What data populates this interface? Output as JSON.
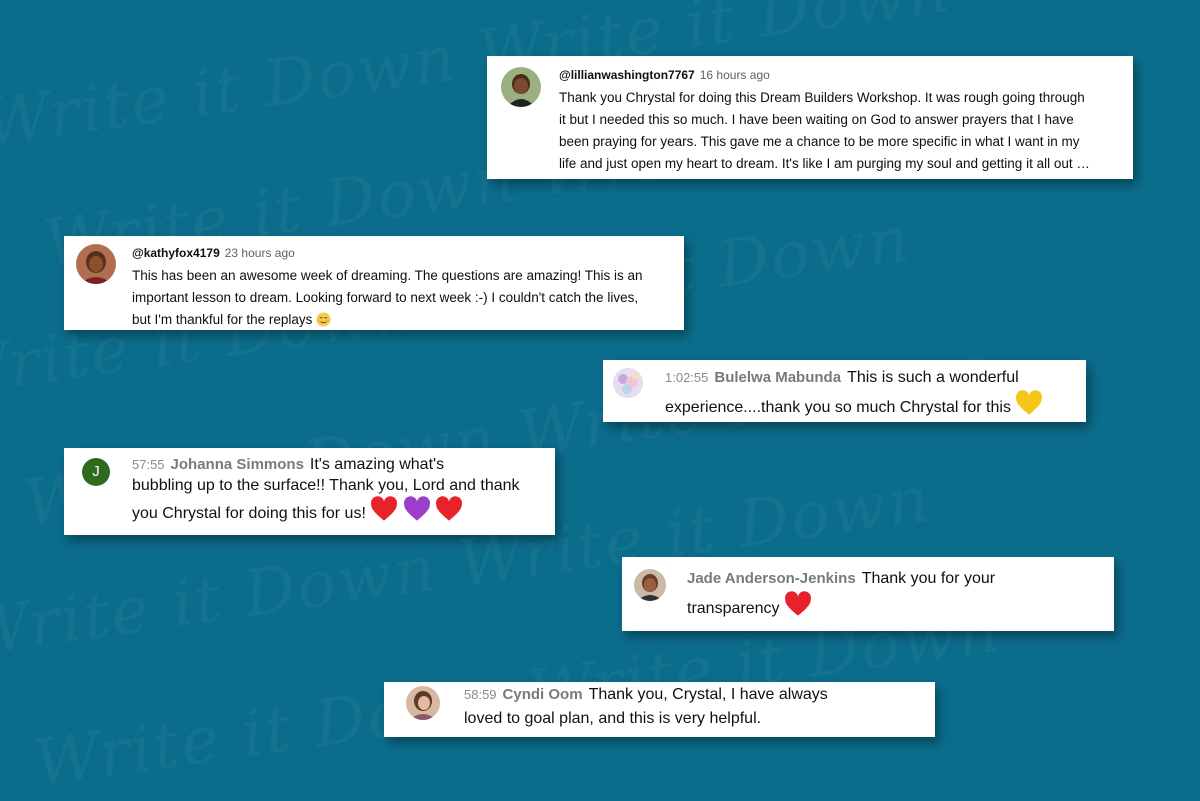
{
  "background": {
    "color": "#0b6d8c",
    "watermark_text": "Write it Down Write it Down"
  },
  "comments": [
    {
      "handle": "@lillianwashington7767",
      "time": "16 hours ago",
      "lines": [
        "Thank you Chrystal for doing this Dream Builders Workshop. It was rough going through",
        "it but I needed this so much. I have been waiting on God to answer prayers that I have",
        "been praying for years. This gave me a chance to be more specific in what I want in my",
        "life and just open my heart to dream. It's like I am purging my soul and getting it all out …"
      ]
    },
    {
      "handle": "@kathyfox4179",
      "time": "23 hours ago",
      "lines": [
        "This has been an awesome week of dreaming. The questions are amazing! This is an",
        "important lesson to dream. Looking forward to next week :-) I couldn't catch the lives,",
        "but I'm thankful for the replays"
      ],
      "emoji": "relieved-face"
    }
  ],
  "chats": [
    {
      "time": "1:02:55",
      "name": "Bulelwa Mabunda",
      "line1": "This is such a wonderful",
      "line2": "experience....thank you so much Chrystal for this",
      "emoji": "yellow-heart"
    },
    {
      "time": "57:55",
      "name": "Johanna Simmons",
      "avatar_letter": "J",
      "avatar_color": "#2e6b1f",
      "line1": "It's amazing what's",
      "line2": "bubbling up to the surface!! Thank you, Lord and thank",
      "line3": "you Chrystal for doing this for us!",
      "emoji": [
        "red-heart",
        "purple-heart",
        "red-heart"
      ]
    },
    {
      "name": "Jade Anderson-Jenkins",
      "line1": "Thank you for your",
      "line2": "transparency",
      "emoji": "red-heart"
    },
    {
      "time": "58:59",
      "name": "Cyndi Oom",
      "line1": "Thank you, Crystal, I have always",
      "line2": "loved to goal plan, and this is very helpful."
    }
  ],
  "colors": {
    "red_heart": "#e8222b",
    "purple_heart": "#9b3fc9",
    "yellow_heart": "#f5c518"
  }
}
